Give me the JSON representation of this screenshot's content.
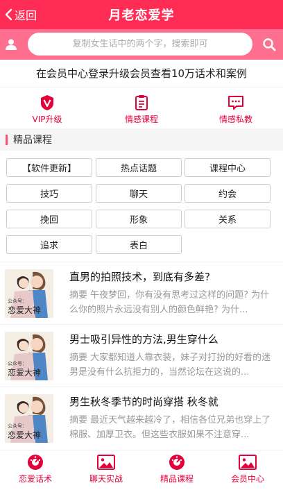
{
  "header": {
    "back_label": "返回",
    "title": "月老恋爱学"
  },
  "search": {
    "placeholder": "复制女生话中的两个字，搜索即可"
  },
  "notice": "在会员中心登录升级会员查看10万话术和案例",
  "quick": [
    {
      "label": "VIP升级",
      "icon": "vip-badge-icon"
    },
    {
      "label": "情感课程",
      "icon": "document-icon"
    },
    {
      "label": "情感私教",
      "icon": "chat-icon"
    }
  ],
  "section_title": "精品课程",
  "tags": [
    "【软件更新】",
    "热点话题",
    "课程中心",
    "技巧",
    "聊天",
    "约会",
    "挽回",
    "形象",
    "关系",
    "追求",
    "表白"
  ],
  "thumb_text": {
    "line1": "公众号：",
    "line2": "恋爱大神"
  },
  "articles": [
    {
      "title": "直男的拍照技术，到底有多差?",
      "summary": "摘要 午夜梦回，你有没有思考过这样的问题? 为什么你的照片永远没有别人的颜色鲜艳? 为什..."
    },
    {
      "title": "男士吸引异性的方法,男生穿什么",
      "summary": "摘要 大家都知道人靠衣装，妹子对打扮的好看的迷男是没有什么抗拒力的，当然论坛在这说的..."
    },
    {
      "title": "男生秋冬季节的时尚穿搭 秋冬就",
      "summary": "摘要 最近天气越来越冷了，相信各位兄弟也穿上了棉服、加厚卫衣。但这些衣服如果不注意穿..."
    }
  ],
  "tabbar": [
    {
      "label": "恋爱话术",
      "icon": "dial-icon"
    },
    {
      "label": "聊天实战",
      "icon": "image-icon"
    },
    {
      "label": "精品课程",
      "icon": "dial-icon"
    },
    {
      "label": "会员中心",
      "icon": "image-icon"
    }
  ],
  "colors": {
    "header": "#ff2d55",
    "searchbar": "#ff6f8f",
    "accent": "#e4003a"
  }
}
